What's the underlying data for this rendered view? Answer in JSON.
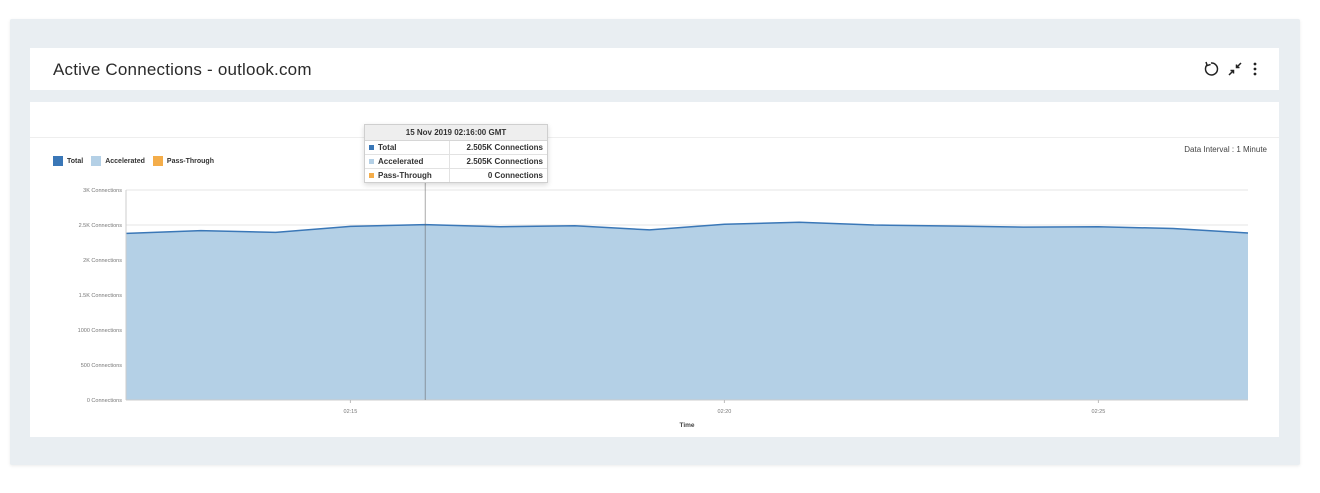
{
  "header": {
    "title": "Active Connections - outlook.com",
    "actions": [
      {
        "icon": "refresh-icon"
      },
      {
        "icon": "collapse-icon"
      },
      {
        "icon": "more-vertical-icon"
      }
    ]
  },
  "legend": {
    "items": [
      {
        "label": "Total",
        "color": "#3a77b7"
      },
      {
        "label": "Accelerated",
        "color": "#b4d0e6"
      },
      {
        "label": "Pass-Through",
        "color": "#f4ad4a"
      }
    ]
  },
  "interval": {
    "label": "Data Interval",
    "value": "1 Minute"
  },
  "tooltip": {
    "time": "15 Nov 2019 02:16:00 GMT",
    "rows": [
      {
        "name": "Total",
        "value": "2.505K Connections",
        "color": "#3a77b7"
      },
      {
        "name": "Accelerated",
        "value": "2.505K Connections",
        "color": "#b4d0e6"
      },
      {
        "name": "Pass-Through",
        "value": "0 Connections",
        "color": "#f4ad4a"
      }
    ]
  },
  "chart_data": {
    "type": "area",
    "xlabel": "Time",
    "ylabel": "",
    "ylim": [
      0,
      3000
    ],
    "yticks": [
      0,
      500,
      1000,
      1500,
      2000,
      2500,
      3000
    ],
    "ytick_labels": [
      "0 Connections",
      "500 Connections",
      "1000 Connections",
      "1.5K Connections",
      "2K Connections",
      "2.5K Connections",
      "3K Connections"
    ],
    "xticks": [
      "02:15",
      "02:20",
      "02:25"
    ],
    "x": [
      "02:12",
      "02:13",
      "02:14",
      "02:15",
      "02:16",
      "02:17",
      "02:18",
      "02:19",
      "02:20",
      "02:21",
      "02:22",
      "02:23",
      "02:24",
      "02:25",
      "02:26",
      "02:27"
    ],
    "series": [
      {
        "name": "Total",
        "color": "#3a77b7",
        "values": [
          2380,
          2420,
          2395,
          2480,
          2505,
          2475,
          2490,
          2430,
          2510,
          2540,
          2500,
          2485,
          2470,
          2475,
          2450,
          2385
        ]
      },
      {
        "name": "Accelerated",
        "color": "#b4d0e6",
        "values": [
          2380,
          2420,
          2395,
          2480,
          2505,
          2475,
          2490,
          2430,
          2510,
          2540,
          2500,
          2485,
          2470,
          2475,
          2450,
          2385
        ]
      },
      {
        "name": "Pass-Through",
        "color": "#f4ad4a",
        "values": [
          0,
          0,
          0,
          0,
          0,
          0,
          0,
          0,
          0,
          0,
          0,
          0,
          0,
          0,
          0,
          0
        ]
      }
    ],
    "hover_x": "02:16",
    "grid": true,
    "legend_position": "top-left"
  }
}
